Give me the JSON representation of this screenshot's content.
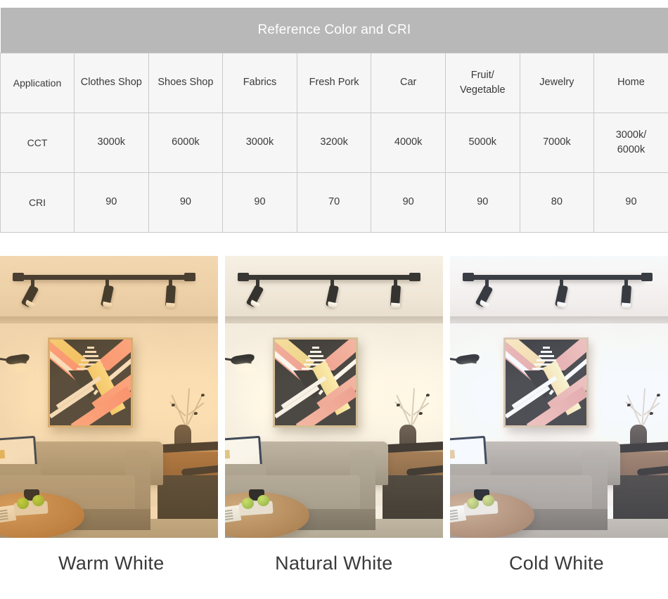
{
  "table": {
    "title": "Reference Color and CRI",
    "title_bg": "#b8b8b8",
    "cell_bg": "#f6f6f6",
    "border_color": "#c9c9c9",
    "columns": [
      "Application",
      "Clothes Shop",
      "Shoes Shop",
      "Fabrics",
      "Fresh Pork",
      "Car",
      "Fruit/\nVegetable",
      "Jewelry",
      "Home"
    ],
    "header_row": {
      "label": "Application",
      "cells": [
        "Clothes Shop",
        "Shoes Shop",
        "Fabrics",
        "Fresh Pork",
        "Car",
        "Fruit/Vegetable",
        "Jewelry",
        "Home"
      ]
    },
    "fruit_line1": "Fruit/",
    "fruit_line2": "Vegetable",
    "rows": [
      {
        "label": "CCT",
        "values": [
          "3000k",
          "6000k",
          "3000k",
          "3200k",
          "4000k",
          "5000k",
          "7000k",
          "3000k/6000k"
        ],
        "home_line1": "3000k/",
        "home_line2": "6000k"
      },
      {
        "label": "CRI",
        "values": [
          "90",
          "90",
          "90",
          "70",
          "90",
          "90",
          "80",
          "90"
        ]
      }
    ]
  },
  "gallery": {
    "panels": [
      {
        "caption": "Warm White",
        "scene_name": "living-room-warm-white",
        "tint": "#ffb04a"
      },
      {
        "caption": "Natural White",
        "scene_name": "living-room-natural-white",
        "tint": "#ffeecd"
      },
      {
        "caption": "Cold White",
        "scene_name": "living-room-cold-white",
        "tint": "#c4dcff"
      }
    ],
    "scene_elements": [
      "track-light",
      "wall-sconce",
      "abstract-painting",
      "sofa",
      "throw-pillow",
      "round-coffee-table",
      "green-apples",
      "coffee-cup",
      "magazine",
      "vase-with-branches",
      "sideboard",
      "lounge-chair"
    ]
  }
}
